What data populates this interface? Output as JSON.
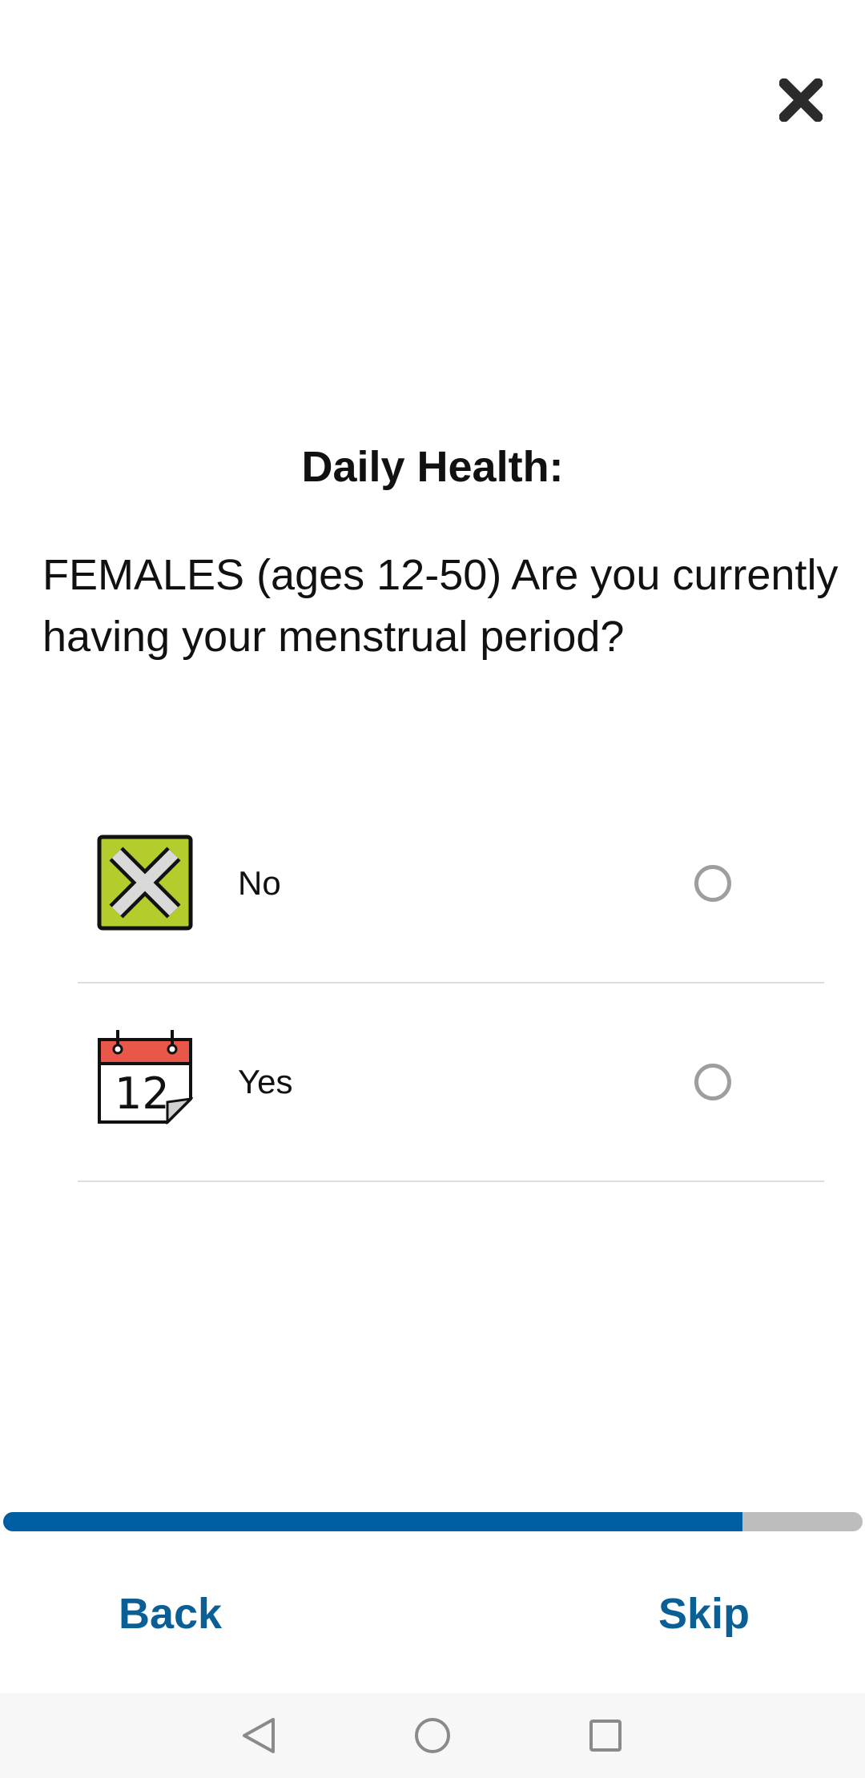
{
  "header": {
    "close_icon": "close-icon"
  },
  "survey": {
    "title": "Daily Health:",
    "question": "FEMALES (ages 12-50) Are you currently having your menstrual period?"
  },
  "options": [
    {
      "label": "No",
      "icon": "x-mark-icon",
      "selected": false
    },
    {
      "label": "Yes",
      "icon": "calendar-icon",
      "selected": false
    }
  ],
  "progress": {
    "fraction": 0.86
  },
  "navigation": {
    "back_label": "Back",
    "skip_label": "Skip"
  },
  "system_nav": {
    "back_icon": "triangle-back-icon",
    "home_icon": "circle-home-icon",
    "recents_icon": "square-recents-icon"
  },
  "colors": {
    "accent": "#005ea2",
    "link": "#0b5f95",
    "progress_track": "#bdbdbd",
    "no_icon_bg": "#b5cc2d",
    "calendar_header": "#e8574a"
  }
}
